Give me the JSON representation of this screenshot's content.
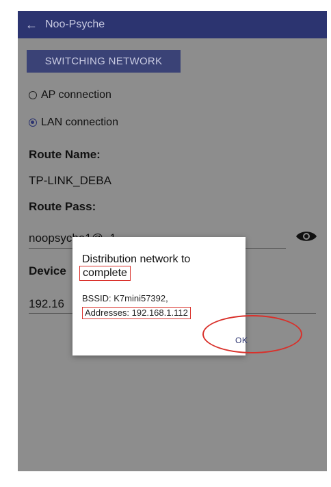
{
  "app_bar": {
    "back_icon": "arrow-left-icon",
    "title": "Noo-Psyche"
  },
  "switch_button": "SWITCHING NETWORK",
  "connection": {
    "options": [
      {
        "label": "AP connection",
        "checked": false
      },
      {
        "label": "LAN connection",
        "checked": true
      }
    ]
  },
  "route_name": {
    "label": "Route Name:",
    "value": "TP-LINK_DEBA"
  },
  "route_pass": {
    "label": "Route Pass:",
    "value": "noopsyche1@_1",
    "eye_icon": "eye-icon"
  },
  "device": {
    "label_visible": "Device",
    "value_visible": "192.16"
  },
  "dialog": {
    "title_line1": "Distribution network to",
    "title_line2": "complete",
    "message_line1": "BSSID: K7mini57392,",
    "message_line2": "Addresses: 192.168.1.112",
    "ok_label": "OK"
  },
  "colors": {
    "app_bar": "#2c3470",
    "scrim_bg": "#8d8d8d",
    "annotation": "#d9302a"
  }
}
